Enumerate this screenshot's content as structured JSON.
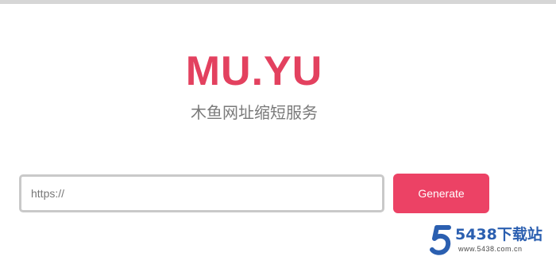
{
  "brand": {
    "logo_text": "MU.YU",
    "subtitle": "木鱼网址缩短服务"
  },
  "form": {
    "url_placeholder": "https://",
    "url_value": "",
    "generate_label": "Generate"
  },
  "watermark": {
    "title": "5438下载站",
    "url": "www.5438.com.cn"
  },
  "colors": {
    "accent": "#ec4265",
    "logo": "#e3415f",
    "subtitle": "#7a7a7a",
    "input_border": "#c9c9c9",
    "watermark_blue": "#2b5fb0",
    "watermark_text": "#4a4a4a"
  },
  "icons": {
    "watermark_logo": "stylized-5-logo"
  }
}
